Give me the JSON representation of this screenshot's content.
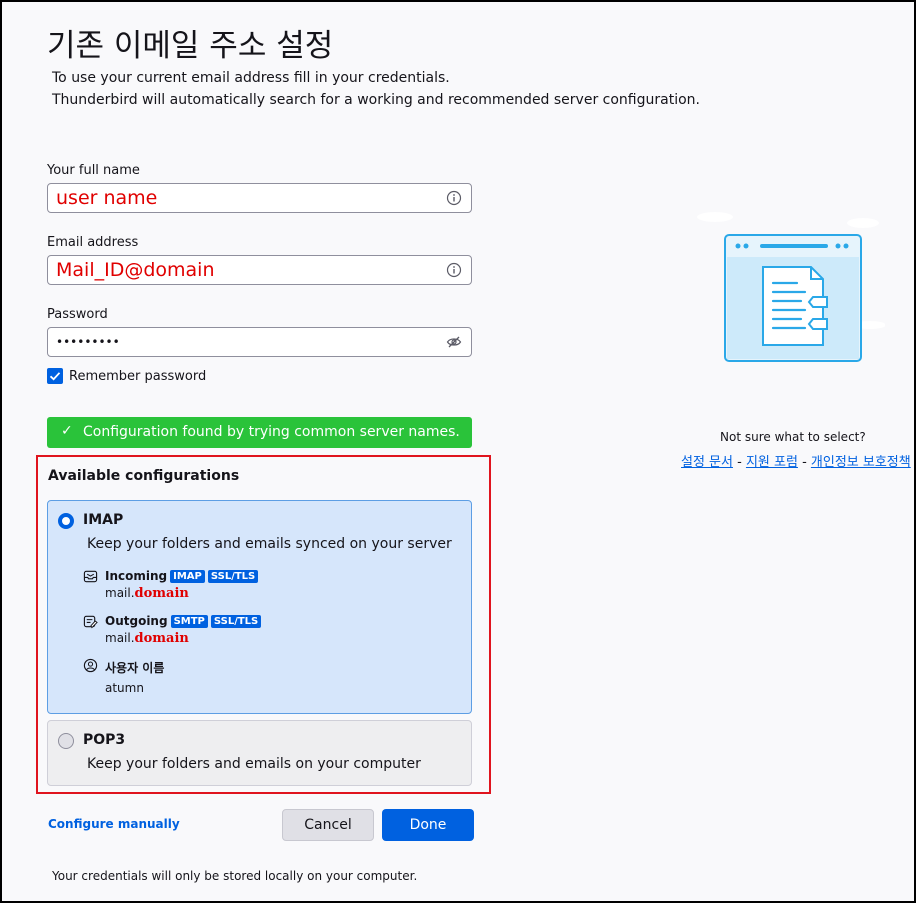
{
  "page": {
    "title": "기존 이메일 주소 설정",
    "subtitle_line1": "To use your current email address fill in your credentials.",
    "subtitle_line2": "Thunderbird will automatically search for a working and recommended server configuration."
  },
  "form": {
    "name_label": "Your full name",
    "name_value": "user name",
    "email_label": "Email address",
    "email_value": "Mail_ID@domain",
    "password_label": "Password",
    "password_value": "•••••••••",
    "remember_label": "Remember password",
    "remember_checked": true
  },
  "status": {
    "success_text": "Configuration found by trying common server names."
  },
  "configs": {
    "heading": "Available configurations",
    "imap": {
      "title": "IMAP",
      "description": "Keep your folders and emails synced on your server",
      "incoming_label": "Incoming",
      "incoming_badges": [
        "IMAP",
        "SSL/TLS"
      ],
      "incoming_host_prefix": "mail.",
      "incoming_host_domain": "domain",
      "outgoing_label": "Outgoing",
      "outgoing_badges": [
        "SMTP",
        "SSL/TLS"
      ],
      "outgoing_host_prefix": "mail.",
      "outgoing_host_domain": "domain",
      "username_label": "사용자 이름",
      "username_value": "atumn",
      "selected": true
    },
    "pop3": {
      "title": "POP3",
      "description": "Keep your folders and emails on your computer",
      "selected": false
    }
  },
  "actions": {
    "configure_manually": "Configure manually",
    "cancel": "Cancel",
    "done": "Done"
  },
  "footer": "Your credentials will only be stored locally on your computer.",
  "help": {
    "not_sure": "Not sure what to select?",
    "link_docs": "설정 문서",
    "link_forum": "지원 포럼",
    "link_privacy": "개인정보 보호정책",
    "separator": " - "
  },
  "colors": {
    "accent": "#0061e0",
    "success": "#2ac33a",
    "highlight_red": "#e00000"
  }
}
